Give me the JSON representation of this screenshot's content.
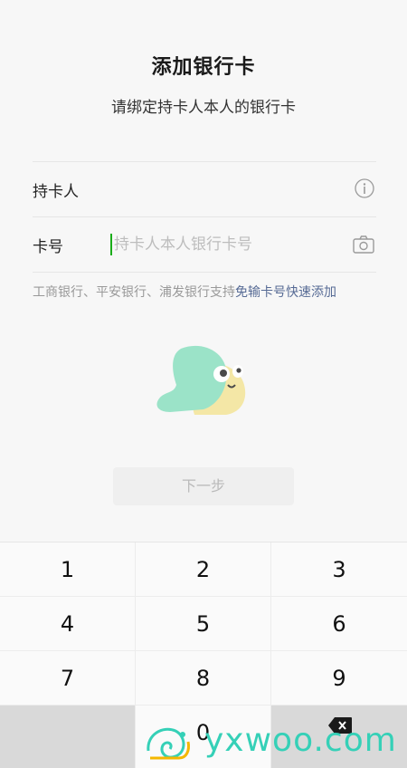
{
  "page": {
    "title": "添加银行卡",
    "subtitle": "请绑定持卡人本人的银行卡"
  },
  "form": {
    "cardholder_label": "持卡人",
    "card_number_label": "卡号",
    "card_number_placeholder": "持卡人本人银行卡号",
    "icons": {
      "info": "info-icon",
      "camera": "camera-icon"
    }
  },
  "hint": {
    "text": "工商银行、平安银行、浦发银行支持",
    "link": "免输卡号快速添加"
  },
  "next_button": {
    "label": "下一步"
  },
  "keypad": {
    "keys": [
      "1",
      "2",
      "3",
      "4",
      "5",
      "6",
      "7",
      "8",
      "9",
      "0"
    ],
    "backspace_icon": "backspace-icon"
  },
  "watermark": {
    "text": "yxwoo.com"
  },
  "colors": {
    "accent_green": "#1aad19",
    "link_blue": "#576b95",
    "watermark_teal": "#35d0b7"
  }
}
